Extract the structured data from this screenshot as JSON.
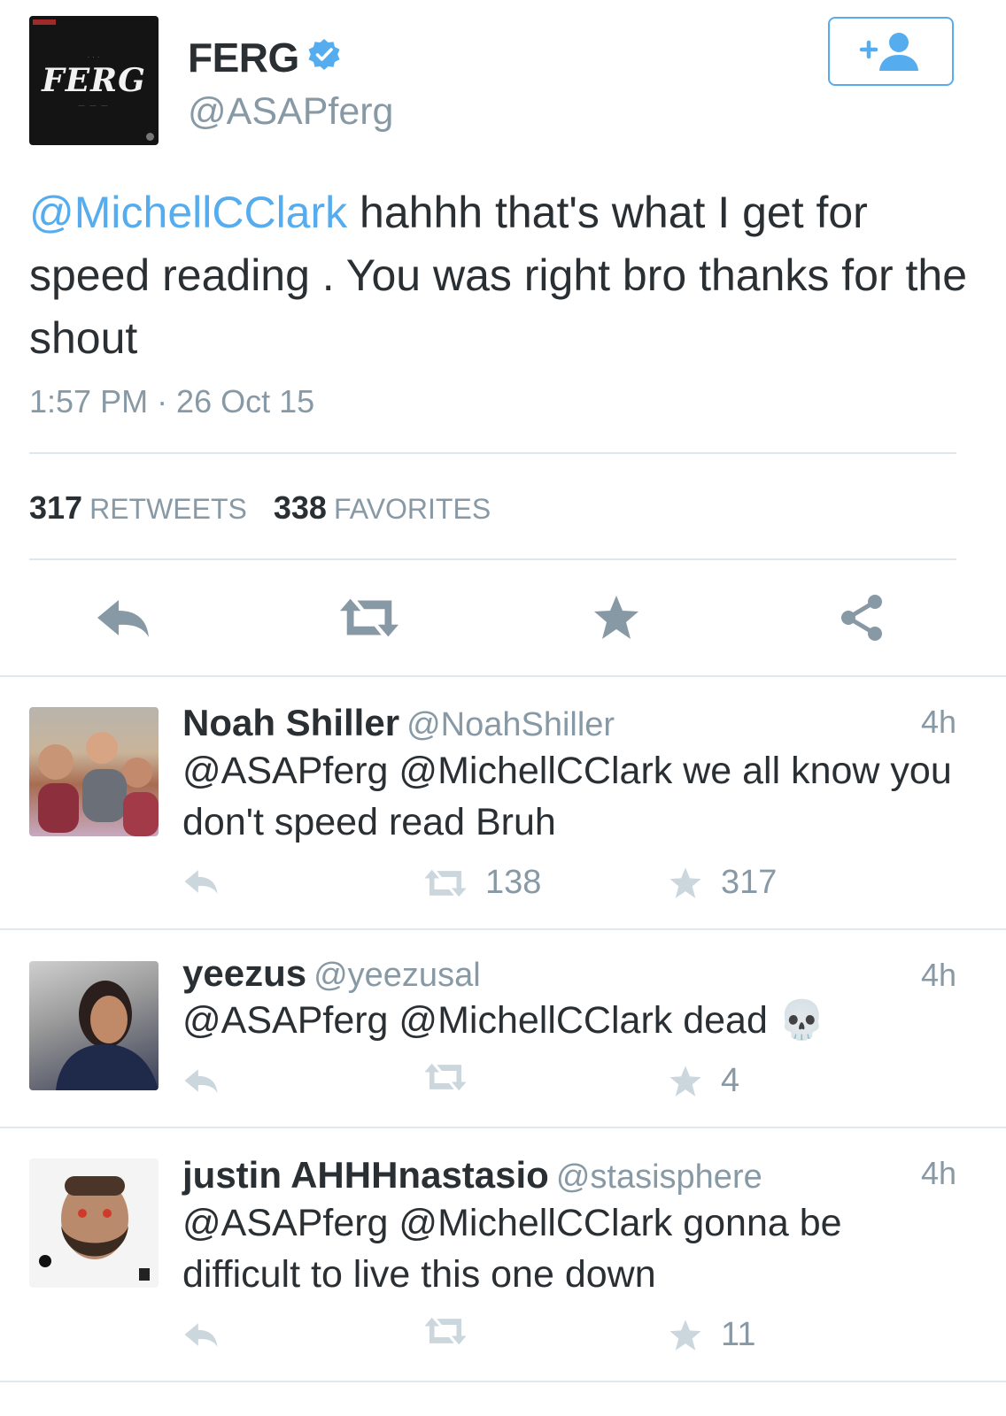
{
  "tweet": {
    "avatar_logo_text": "FERG",
    "display_name": "FERG",
    "handle": "@ASAPferg",
    "mention": "@MichellCClark",
    "body": " hahhh that's what I get for speed reading . You was right bro thanks for the shout",
    "timestamp": "1:57 PM · 26 Oct 15",
    "retweets_count": "317",
    "retweets_label": "RETWEETS",
    "favorites_count": "338",
    "favorites_label": "FAVORITES"
  },
  "icons": {
    "verified": "verified-check-icon",
    "follow": "add-user-icon",
    "reply": "reply-icon",
    "retweet": "retweet-icon",
    "favorite": "star-icon",
    "share": "share-icon"
  },
  "colors": {
    "accent": "#55acee",
    "muted": "#8899a6",
    "text": "#292f33",
    "divider": "#e1e8ed"
  },
  "replies": [
    {
      "name": "Noah Shiller",
      "handle": "@NoahShiller",
      "time": "4h",
      "text": "@ASAPferg @MichellCClark we all know you don't speed read Bruh",
      "retweets": "138",
      "favorites": "317"
    },
    {
      "name": "yeezus",
      "handle": "@yeezusal",
      "time": "4h",
      "text": "@ASAPferg @MichellCClark dead 💀",
      "retweets": "",
      "favorites": "4"
    },
    {
      "name": "justin AHHHnastasio",
      "handle": "@stasisphere",
      "time": "4h",
      "text": "@ASAPferg @MichellCClark gonna be difficult to live this one down",
      "retweets": "",
      "favorites": "11"
    }
  ]
}
